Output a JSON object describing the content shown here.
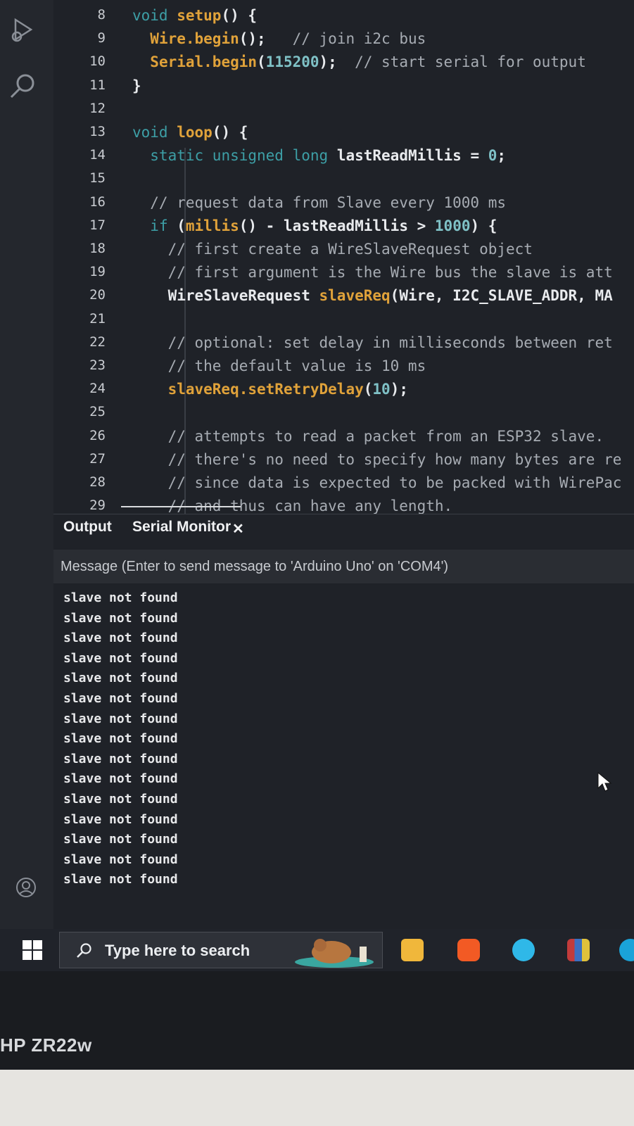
{
  "editor": {
    "lines": [
      {
        "n": "8",
        "tokens": [
          [
            "kw",
            "void "
          ],
          [
            "fn",
            "setup"
          ],
          [
            "id",
            "() {"
          ]
        ]
      },
      {
        "n": "9",
        "tokens": [
          [
            "id",
            "  "
          ],
          [
            "fn",
            "Wire.begin"
          ],
          [
            "id",
            "();"
          ],
          [
            "cm",
            "   // join i2c bus"
          ]
        ]
      },
      {
        "n": "10",
        "tokens": [
          [
            "id",
            "  "
          ],
          [
            "fn",
            "Serial.begin"
          ],
          [
            "id",
            "("
          ],
          [
            "num",
            "115200"
          ],
          [
            "id",
            ");"
          ],
          [
            "cm",
            "  // start serial for output"
          ]
        ]
      },
      {
        "n": "11",
        "tokens": [
          [
            "id",
            "}"
          ]
        ]
      },
      {
        "n": "12",
        "tokens": []
      },
      {
        "n": "13",
        "tokens": [
          [
            "kw",
            "void "
          ],
          [
            "fn",
            "loop"
          ],
          [
            "id",
            "() {"
          ]
        ]
      },
      {
        "n": "14",
        "tokens": [
          [
            "id",
            "  "
          ],
          [
            "type",
            "static unsigned long "
          ],
          [
            "id",
            "lastReadMillis = "
          ],
          [
            "num",
            "0"
          ],
          [
            "id",
            ";"
          ]
        ]
      },
      {
        "n": "15",
        "tokens": []
      },
      {
        "n": "16",
        "tokens": [
          [
            "cm",
            "  // request data from Slave every 1000 ms"
          ]
        ]
      },
      {
        "n": "17",
        "tokens": [
          [
            "id",
            "  "
          ],
          [
            "kw",
            "if "
          ],
          [
            "id",
            "("
          ],
          [
            "fn",
            "millis"
          ],
          [
            "id",
            "() - lastReadMillis > "
          ],
          [
            "num",
            "1000"
          ],
          [
            "id",
            ") {"
          ]
        ]
      },
      {
        "n": "18",
        "tokens": [
          [
            "cm",
            "    // first create a WireSlaveRequest object"
          ]
        ]
      },
      {
        "n": "19",
        "tokens": [
          [
            "cm",
            "    // first argument is the Wire bus the slave is att"
          ]
        ]
      },
      {
        "n": "20",
        "tokens": [
          [
            "id",
            "    WireSlaveRequest "
          ],
          [
            "fn",
            "slaveReq"
          ],
          [
            "id",
            "(Wire, I2C_SLAVE_ADDR, MA"
          ]
        ]
      },
      {
        "n": "21",
        "tokens": []
      },
      {
        "n": "22",
        "tokens": [
          [
            "cm",
            "    // optional: set delay in milliseconds between ret"
          ]
        ]
      },
      {
        "n": "23",
        "tokens": [
          [
            "cm",
            "    // the default value is 10 ms"
          ]
        ]
      },
      {
        "n": "24",
        "tokens": [
          [
            "id",
            "    "
          ],
          [
            "fn",
            "slaveReq.setRetryDelay"
          ],
          [
            "id",
            "("
          ],
          [
            "num",
            "10"
          ],
          [
            "id",
            ");"
          ]
        ]
      },
      {
        "n": "25",
        "tokens": []
      },
      {
        "n": "26",
        "tokens": [
          [
            "cm",
            "    // attempts to read a packet from an ESP32 slave."
          ]
        ]
      },
      {
        "n": "27",
        "tokens": [
          [
            "cm",
            "    // there's no need to specify how many bytes are re"
          ]
        ]
      },
      {
        "n": "28",
        "tokens": [
          [
            "cm",
            "    // since data is expected to be packed with WirePac"
          ]
        ]
      },
      {
        "n": "29",
        "tokens": [
          [
            "cm",
            "    // and thus can have any length."
          ]
        ]
      }
    ]
  },
  "panel": {
    "tab_output": "Output",
    "tab_serial": "Serial Monitor",
    "close_glyph": "✕",
    "message_placeholder": "Message (Enter to send message to 'Arduino Uno' on 'COM4')",
    "serial_lines": [
      "slave not found",
      "slave not found",
      "slave not found",
      "slave not found",
      "slave not found",
      "slave not found",
      "slave not found",
      "slave not found",
      "slave not found",
      "slave not found",
      "slave not found",
      "slave not found",
      "slave not found",
      "slave not found",
      "slave not found"
    ]
  },
  "taskbar": {
    "search_text": "Type here to search",
    "apps": [
      "file-explorer-icon",
      "brave-icon",
      "app-c-icon",
      "winrar-icon",
      "edge-icon"
    ]
  },
  "bezel": {
    "label": "HP ZR22w"
  },
  "colors": {
    "keyword": "#3d9fa6",
    "function": "#e0a23a",
    "comment": "#a7acb3",
    "number": "#7fc1c6"
  }
}
